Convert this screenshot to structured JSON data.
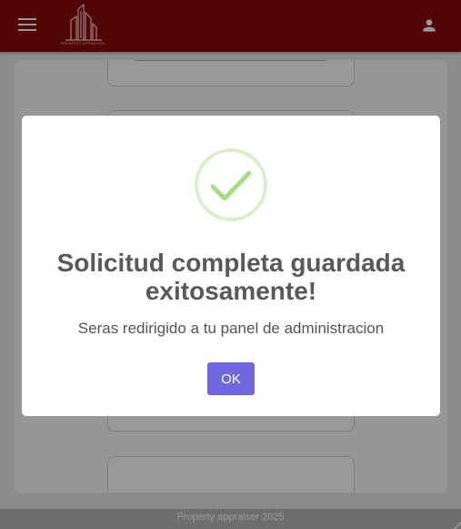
{
  "header": {
    "logo_text": "PROPERTY APPRAISER",
    "menu_icon": "menu-icon",
    "user_icon": "person-icon",
    "background_color": "#8b0a0a"
  },
  "footer": {
    "text": "Property appraiser 2025"
  },
  "dialog": {
    "icon": "success-check-icon",
    "title": "Solicitud completa guardada exitosamente!",
    "message": "Seras redirigido a tu panel de administracion",
    "ok_label": "OK",
    "button_color": "#7066e0",
    "success_color": "#a5dc86"
  }
}
